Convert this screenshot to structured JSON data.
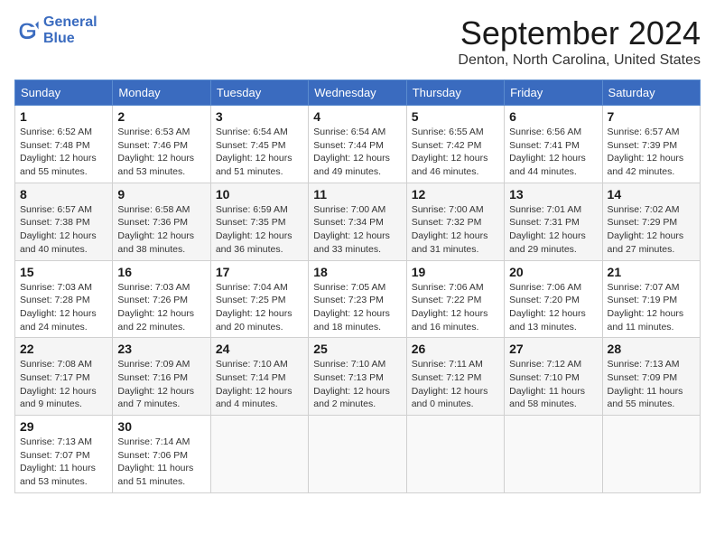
{
  "header": {
    "logo_line1": "General",
    "logo_line2": "Blue",
    "month_title": "September 2024",
    "location": "Denton, North Carolina, United States"
  },
  "days_of_week": [
    "Sunday",
    "Monday",
    "Tuesday",
    "Wednesday",
    "Thursday",
    "Friday",
    "Saturday"
  ],
  "weeks": [
    [
      {
        "day": "1",
        "sunrise": "6:52 AM",
        "sunset": "7:48 PM",
        "daylight": "12 hours and 55 minutes."
      },
      {
        "day": "2",
        "sunrise": "6:53 AM",
        "sunset": "7:46 PM",
        "daylight": "12 hours and 53 minutes."
      },
      {
        "day": "3",
        "sunrise": "6:54 AM",
        "sunset": "7:45 PM",
        "daylight": "12 hours and 51 minutes."
      },
      {
        "day": "4",
        "sunrise": "6:54 AM",
        "sunset": "7:44 PM",
        "daylight": "12 hours and 49 minutes."
      },
      {
        "day": "5",
        "sunrise": "6:55 AM",
        "sunset": "7:42 PM",
        "daylight": "12 hours and 46 minutes."
      },
      {
        "day": "6",
        "sunrise": "6:56 AM",
        "sunset": "7:41 PM",
        "daylight": "12 hours and 44 minutes."
      },
      {
        "day": "7",
        "sunrise": "6:57 AM",
        "sunset": "7:39 PM",
        "daylight": "12 hours and 42 minutes."
      }
    ],
    [
      {
        "day": "8",
        "sunrise": "6:57 AM",
        "sunset": "7:38 PM",
        "daylight": "12 hours and 40 minutes."
      },
      {
        "day": "9",
        "sunrise": "6:58 AM",
        "sunset": "7:36 PM",
        "daylight": "12 hours and 38 minutes."
      },
      {
        "day": "10",
        "sunrise": "6:59 AM",
        "sunset": "7:35 PM",
        "daylight": "12 hours and 36 minutes."
      },
      {
        "day": "11",
        "sunrise": "7:00 AM",
        "sunset": "7:34 PM",
        "daylight": "12 hours and 33 minutes."
      },
      {
        "day": "12",
        "sunrise": "7:00 AM",
        "sunset": "7:32 PM",
        "daylight": "12 hours and 31 minutes."
      },
      {
        "day": "13",
        "sunrise": "7:01 AM",
        "sunset": "7:31 PM",
        "daylight": "12 hours and 29 minutes."
      },
      {
        "day": "14",
        "sunrise": "7:02 AM",
        "sunset": "7:29 PM",
        "daylight": "12 hours and 27 minutes."
      }
    ],
    [
      {
        "day": "15",
        "sunrise": "7:03 AM",
        "sunset": "7:28 PM",
        "daylight": "12 hours and 24 minutes."
      },
      {
        "day": "16",
        "sunrise": "7:03 AM",
        "sunset": "7:26 PM",
        "daylight": "12 hours and 22 minutes."
      },
      {
        "day": "17",
        "sunrise": "7:04 AM",
        "sunset": "7:25 PM",
        "daylight": "12 hours and 20 minutes."
      },
      {
        "day": "18",
        "sunrise": "7:05 AM",
        "sunset": "7:23 PM",
        "daylight": "12 hours and 18 minutes."
      },
      {
        "day": "19",
        "sunrise": "7:06 AM",
        "sunset": "7:22 PM",
        "daylight": "12 hours and 16 minutes."
      },
      {
        "day": "20",
        "sunrise": "7:06 AM",
        "sunset": "7:20 PM",
        "daylight": "12 hours and 13 minutes."
      },
      {
        "day": "21",
        "sunrise": "7:07 AM",
        "sunset": "7:19 PM",
        "daylight": "12 hours and 11 minutes."
      }
    ],
    [
      {
        "day": "22",
        "sunrise": "7:08 AM",
        "sunset": "7:17 PM",
        "daylight": "12 hours and 9 minutes."
      },
      {
        "day": "23",
        "sunrise": "7:09 AM",
        "sunset": "7:16 PM",
        "daylight": "12 hours and 7 minutes."
      },
      {
        "day": "24",
        "sunrise": "7:10 AM",
        "sunset": "7:14 PM",
        "daylight": "12 hours and 4 minutes."
      },
      {
        "day": "25",
        "sunrise": "7:10 AM",
        "sunset": "7:13 PM",
        "daylight": "12 hours and 2 minutes."
      },
      {
        "day": "26",
        "sunrise": "7:11 AM",
        "sunset": "7:12 PM",
        "daylight": "12 hours and 0 minutes."
      },
      {
        "day": "27",
        "sunrise": "7:12 AM",
        "sunset": "7:10 PM",
        "daylight": "11 hours and 58 minutes."
      },
      {
        "day": "28",
        "sunrise": "7:13 AM",
        "sunset": "7:09 PM",
        "daylight": "11 hours and 55 minutes."
      }
    ],
    [
      {
        "day": "29",
        "sunrise": "7:13 AM",
        "sunset": "7:07 PM",
        "daylight": "11 hours and 53 minutes."
      },
      {
        "day": "30",
        "sunrise": "7:14 AM",
        "sunset": "7:06 PM",
        "daylight": "11 hours and 51 minutes."
      },
      null,
      null,
      null,
      null,
      null
    ]
  ]
}
